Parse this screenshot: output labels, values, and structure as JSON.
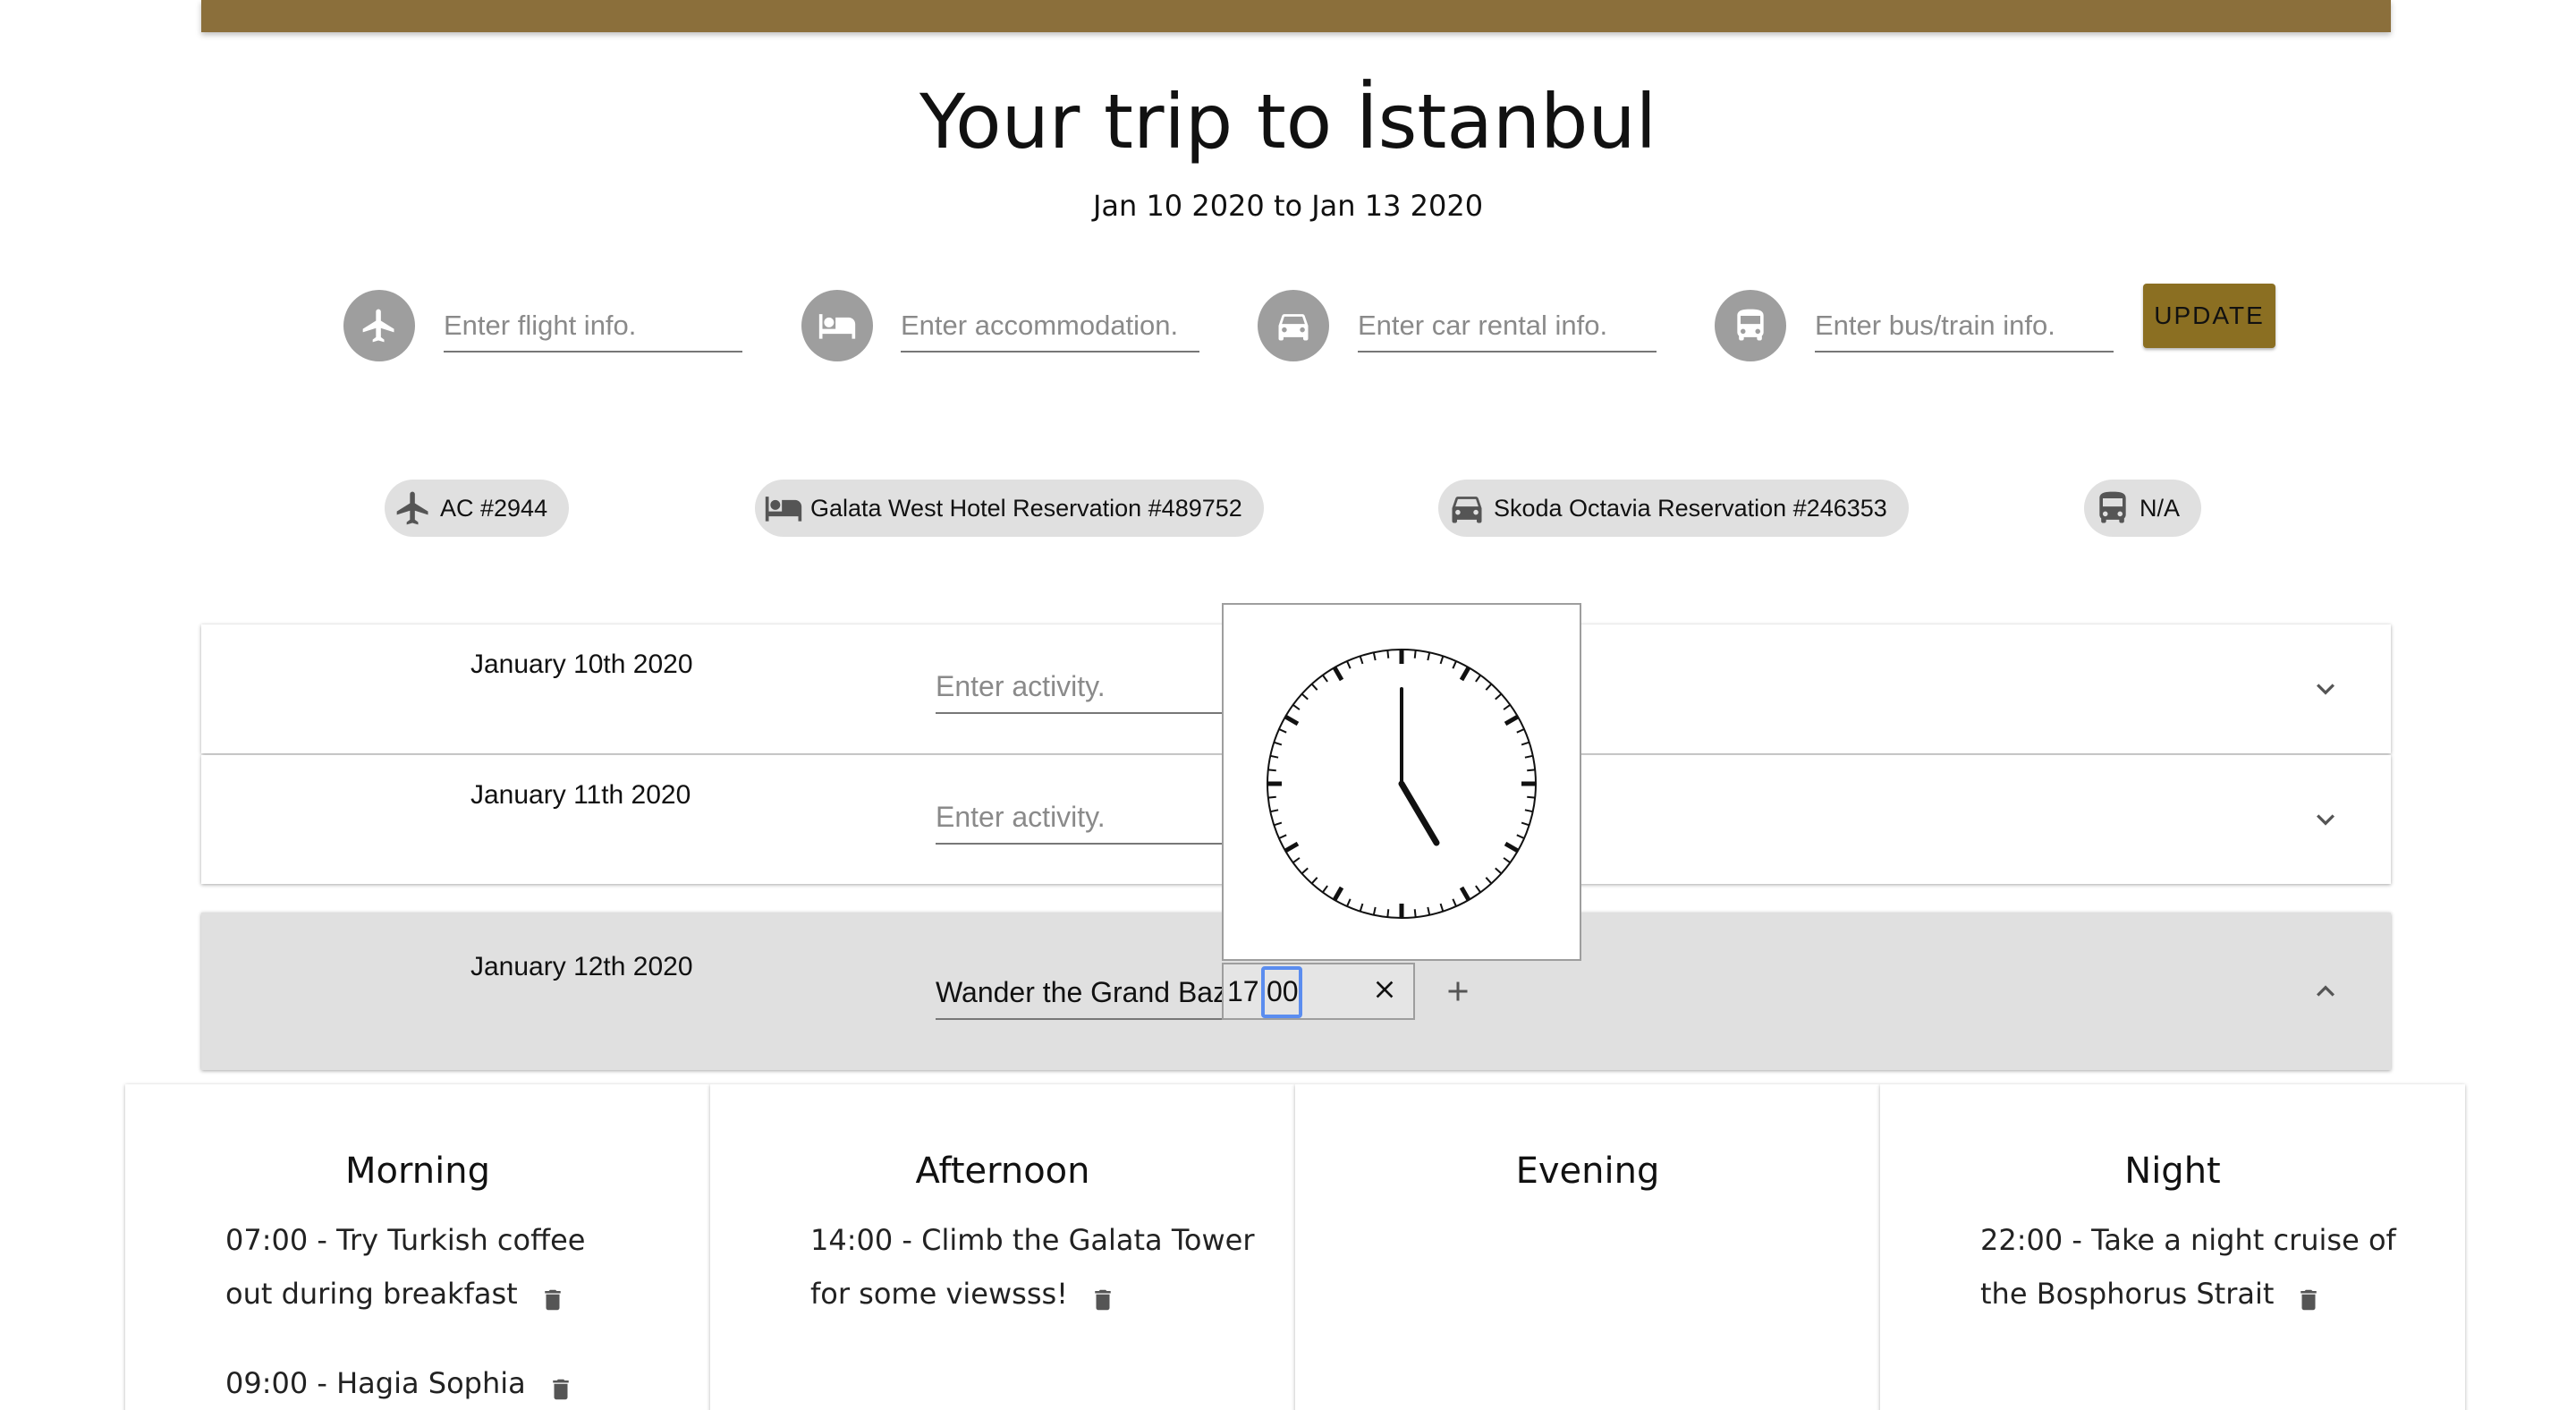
{
  "header": {
    "title": "Your trip to İstanbul",
    "dates": "Jan 10 2020 to Jan 13 2020"
  },
  "inputs": {
    "flight_placeholder": "Enter flight info.",
    "accommodation_placeholder": "Enter accommodation.",
    "car_placeholder": "Enter car rental info.",
    "transit_placeholder": "Enter bus/train info.",
    "update_label": "UPDATE"
  },
  "chips": {
    "flight": "AC #2944",
    "hotel": "Galata West Hotel Reservation #489752",
    "car": "Skoda Octavia Reservation #246353",
    "transit": "N/A"
  },
  "days": [
    {
      "label": "January 10th 2020",
      "activity_placeholder": "Enter activity.",
      "activity_value": ""
    },
    {
      "label": "January 11th 2020",
      "activity_placeholder": "Enter activity.",
      "activity_value": ""
    },
    {
      "label": "January 12th 2020",
      "activity_placeholder": "Enter activity.",
      "activity_value": "Wander the Grand Bazaar"
    }
  ],
  "time_picker": {
    "hour": "17",
    "sep": ":",
    "minute": "00",
    "clear_icon": "close-icon",
    "add_icon": "plus-icon"
  },
  "periods": [
    {
      "title": "Morning",
      "items": [
        "07:00 - Try Turkish coffee out during breakfast",
        "09:00 - Hagia Sophia"
      ]
    },
    {
      "title": "Afternoon",
      "items": [
        "14:00 - Climb the Galata Tower for some viewsss!"
      ]
    },
    {
      "title": "Evening",
      "items": []
    },
    {
      "title": "Night",
      "items": [
        "22:00 - Take a night cruise of the Bosphorus Strait"
      ]
    }
  ],
  "colors": {
    "accent": "#8b6f3b",
    "button": "#8b6f22",
    "expanded_row": "#e0e0e0"
  }
}
